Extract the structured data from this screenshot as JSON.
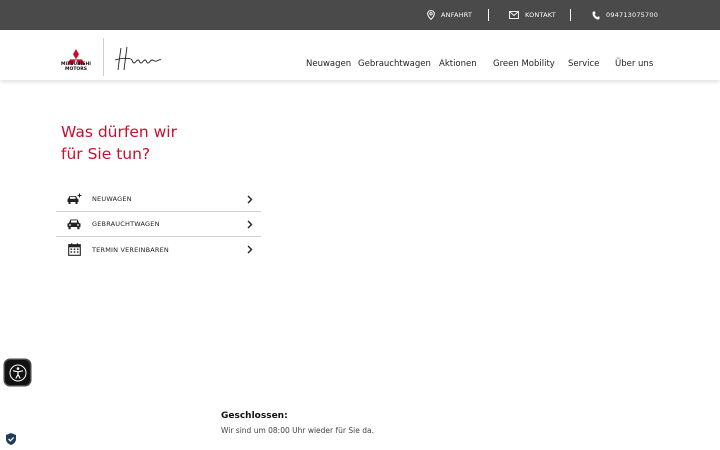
{
  "topbar": {
    "directions": "ANFAHRT",
    "contact": "KONTAKT",
    "phone": "094713075700"
  },
  "brand": {
    "logo_text_line1": "MITSUBISHI",
    "logo_text_line2": "MOTORS",
    "signature_text": "Hammer",
    "red": "#c8102e"
  },
  "nav": {
    "new_cars": "Neuwagen",
    "used_cars": "Gebrauchtwagen",
    "promotions": "Aktionen",
    "green_mobility": "Green Mobility",
    "service": "Service",
    "about": "Über uns"
  },
  "hero": {
    "title_line1": "Was dürfen wir",
    "title_line2": "für Sie tun?"
  },
  "menu": {
    "items": [
      {
        "label": "NEUWAGEN",
        "icon": "new-car-icon"
      },
      {
        "label": "GEBRAUCHTWAGEN",
        "icon": "car-icon"
      },
      {
        "label": "TERMIN VEREINBAREN",
        "icon": "calendar-icon"
      }
    ]
  },
  "status": {
    "title": "Geschlossen:",
    "text": "Wir sind um 08:00 Uhr wieder für Sie da."
  }
}
